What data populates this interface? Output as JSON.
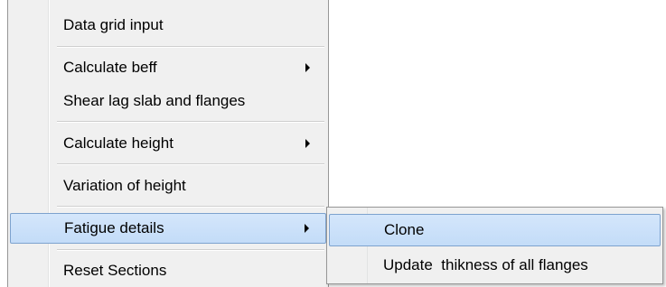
{
  "context_menu": {
    "items": [
      {
        "label": "Data grid input"
      },
      {
        "label": "Calculate beff"
      },
      {
        "label": "Shear lag slab and flanges"
      },
      {
        "label": "Calculate height"
      },
      {
        "label": "Variation of height"
      },
      {
        "label": "Fatigue details"
      },
      {
        "label": "Reset Sections"
      }
    ]
  },
  "submenu": {
    "items": [
      {
        "label": "Clone"
      },
      {
        "label": "Update  thikness of all flanges"
      }
    ]
  },
  "colors": {
    "menu_background": "#f0f0f0",
    "highlight_fill": "#c9e0fa",
    "highlight_border": "#7da2ce"
  }
}
